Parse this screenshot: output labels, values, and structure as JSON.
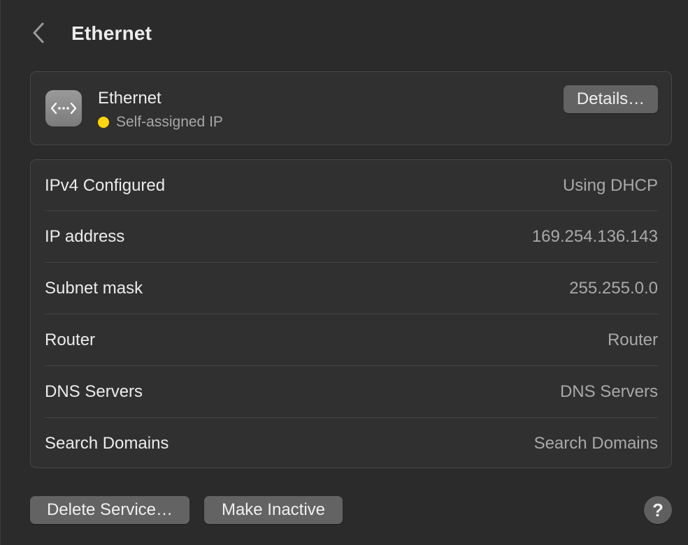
{
  "header": {
    "title": "Ethernet",
    "back_icon": "chevron-left-icon"
  },
  "service": {
    "icon": "ethernet-icon",
    "name": "Ethernet",
    "status": "Self-assigned IP",
    "status_color": "#ffd60a",
    "details_label": "Details…"
  },
  "info_rows": [
    {
      "label": "IPv4 Configured",
      "value": "Using DHCP"
    },
    {
      "label": "IP address",
      "value": "169.254.136.143"
    },
    {
      "label": "Subnet mask",
      "value": "255.255.0.0"
    },
    {
      "label": "Router",
      "value": "Router"
    },
    {
      "label": "DNS Servers",
      "value": "DNS Servers"
    },
    {
      "label": "Search Domains",
      "value": "Search Domains"
    }
  ],
  "footer": {
    "delete_label": "Delete Service…",
    "inactive_label": "Make Inactive",
    "help_label": "?"
  }
}
